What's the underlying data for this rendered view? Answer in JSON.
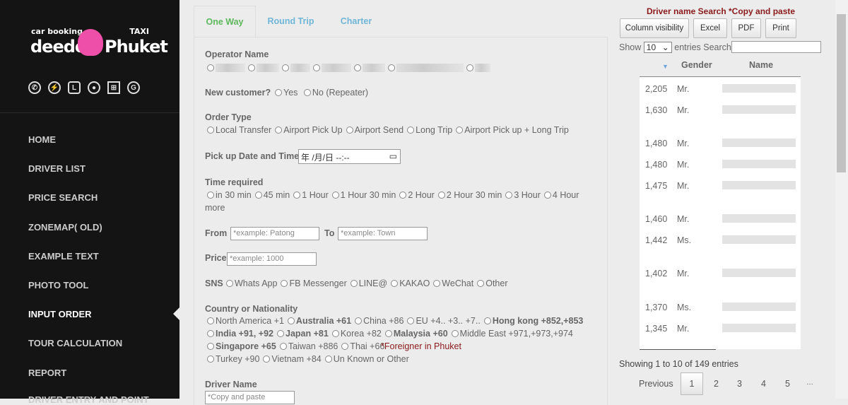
{
  "sidebar": {
    "logo": {
      "top_left": "car booking",
      "top_right": "TAXI",
      "left": "deedee",
      "right": "Phuket"
    },
    "social_icons": [
      "whatsapp-icon",
      "messenger-icon",
      "line-icon",
      "wechat-icon",
      "windows-icon",
      "google-icon"
    ],
    "items": [
      {
        "label": "HOME"
      },
      {
        "label": "DRIVER LIST"
      },
      {
        "label": "PRICE SEARCH"
      },
      {
        "label": "ZONEMAP( OLD)"
      },
      {
        "label": "EXAMPLE TEXT"
      },
      {
        "label": "PHOTO TOOL"
      },
      {
        "label": "INPUT ORDER",
        "active": true
      },
      {
        "label": "TOUR CALCULATION"
      },
      {
        "label": "REPORT"
      },
      {
        "label": "DRIVER ENTRY AND POINT"
      }
    ]
  },
  "tabs": [
    {
      "label": "One Way",
      "active": true
    },
    {
      "label": "Round Trip"
    },
    {
      "label": "Charter"
    }
  ],
  "form": {
    "operator_label": "Operator Name",
    "new_customer_label": "New customer?",
    "new_customer_options": [
      "Yes",
      "No (Repeater)"
    ],
    "order_type_label": "Order Type",
    "order_type_options": [
      "Local Transfer",
      "Airport Pick Up",
      "Airport Send",
      "Long Trip",
      "Airport Pick up + Long Trip"
    ],
    "pickup_label": "Pick up Date and Time",
    "pickup_value": "年 /月/日 --:--",
    "time_label": "Time required",
    "time_options": [
      "in 30 min",
      "45 min",
      "1 Hour",
      "1 Hour 30 min",
      "2 Hour",
      "2 Hour 30 min",
      "3 Hour",
      "4 Hour"
    ],
    "time_more": "more",
    "from_label": "From",
    "from_placeholder": "*example: Patong",
    "to_label": "To",
    "to_placeholder": "*example: Town",
    "price_label": "Price",
    "price_placeholder": "*example: 1000",
    "sns_label": "SNS",
    "sns_options": [
      "Whats App",
      "FB Messenger",
      "LINE@",
      "KAKAO",
      "WeChat",
      "Other"
    ],
    "country_label": "Country or Nationality",
    "country_rows": [
      [
        "North America +1",
        "Australia +61",
        "China +86",
        "EU +4.. +3.. +7..",
        "Hong kong +852,+853"
      ],
      [
        "India +91, +92",
        "Japan +81",
        "Korea +82",
        "Malaysia +60",
        "Middle East +971,+973,+974"
      ],
      [
        "Singapore +65",
        "Taiwan +886",
        "Thai +66"
      ],
      [
        "Turkey +90",
        "Vietnam +84",
        "Un Known or Other"
      ]
    ],
    "foreigner_note": "*Foreigner in Phuket",
    "driver_label": "Driver Name",
    "driver_placeholder": "*Copy and paste"
  },
  "driver_search": {
    "title": "Driver name Search *Copy and paste",
    "buttons": [
      "Column visibility",
      "Excel",
      "PDF",
      "Print"
    ],
    "show_label": "Show",
    "show_value": "10",
    "entries_label": "entries Search:",
    "search_value": "",
    "columns": [
      "Gender",
      "Name"
    ],
    "rows": [
      {
        "n": "2,205",
        "t": "Mr."
      },
      {
        "n": "1,630",
        "t": "Mr."
      },
      {
        "n": "1,480",
        "t": "Mr."
      },
      {
        "n": "1,480",
        "t": "Mr."
      },
      {
        "n": "1,475",
        "t": "Mr."
      },
      {
        "n": "1,460",
        "t": "Mr."
      },
      {
        "n": "1,442",
        "t": "Ms."
      },
      {
        "n": "1,402",
        "t": "Mr."
      },
      {
        "n": "1,370",
        "t": "Ms."
      },
      {
        "n": "1,345",
        "t": "Mr."
      }
    ],
    "info": "Showing 1 to 10 of 149 entries",
    "pagination": {
      "previous": "Previous",
      "pages": [
        "1",
        "2",
        "3",
        "4",
        "5"
      ],
      "ellipsis": "…",
      "current": "1"
    }
  },
  "colors": {
    "sidebar_bg": "#141414",
    "active_tab": "#5cb85c",
    "tab": "#6fb6d8",
    "title_red": "#8b1a1a",
    "logo_pink": "#ee4fa8"
  }
}
